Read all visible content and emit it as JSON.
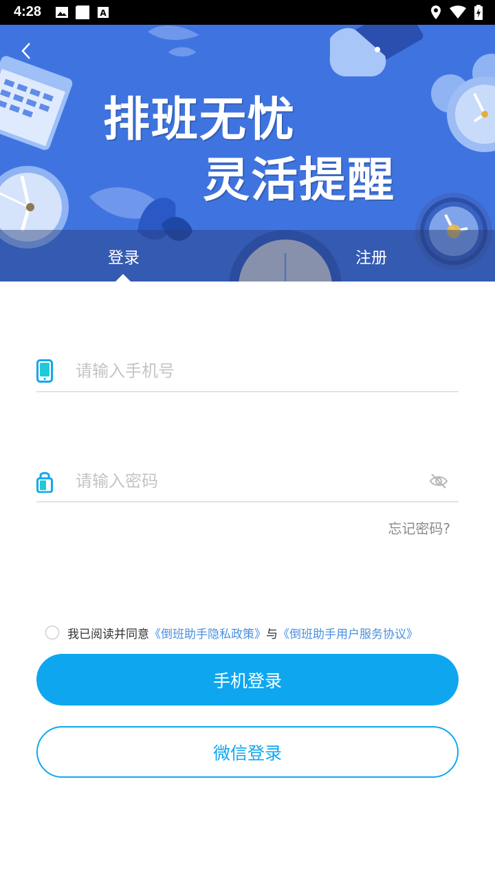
{
  "status_bar": {
    "time": "4:28",
    "left_icons": [
      "image-icon",
      "square-icon",
      "font-icon"
    ],
    "right_icons": [
      "location-icon",
      "wifi-icon",
      "battery-icon"
    ]
  },
  "banner": {
    "slogan_line1": "排班无忧",
    "slogan_line2": "灵活提醒",
    "background_color": "#3f74e0"
  },
  "tabs": [
    {
      "label": "登录",
      "active": true
    },
    {
      "label": "注册",
      "active": false
    }
  ],
  "form": {
    "phone_placeholder": "请输入手机号",
    "password_placeholder": "请输入密码",
    "forgot_password": "忘记密码?"
  },
  "agreement": {
    "prefix": "我已阅读并同意",
    "privacy_link": "《倒班助手隐私政策》",
    "connector": "与",
    "terms_link": "《倒班助手用户服务协议》"
  },
  "buttons": {
    "phone_login": "手机登录",
    "wechat_login": "微信登录"
  },
  "colors": {
    "accent": "#0ea7ef",
    "link": "#4a8fe0",
    "icon_teal": "#1fc9d6"
  }
}
